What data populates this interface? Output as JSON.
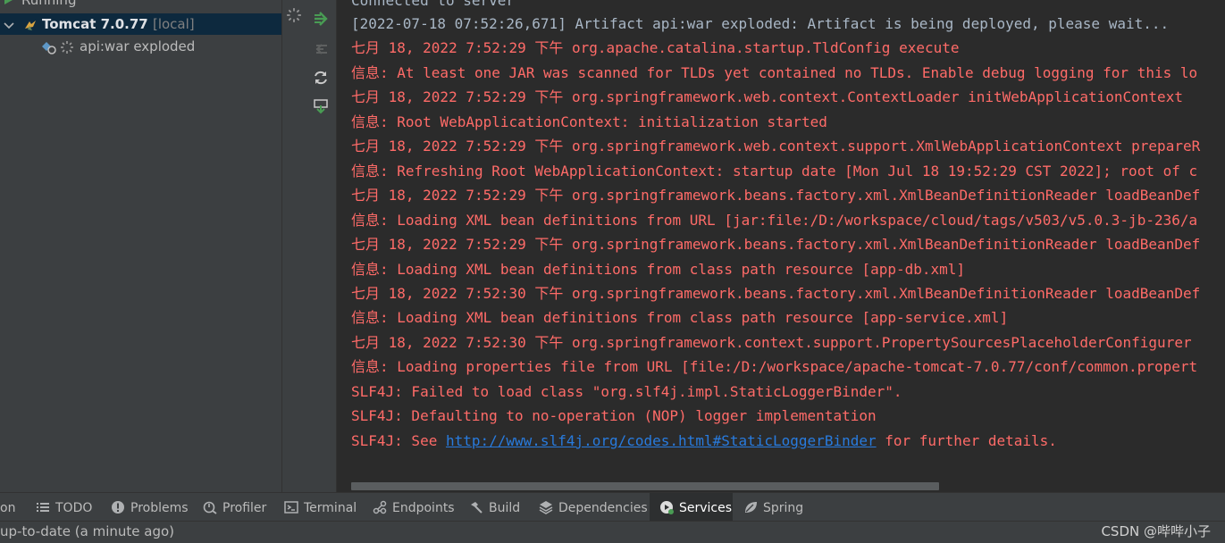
{
  "tree": {
    "running_label": "Running",
    "tomcat_name": "Tomcat 7.0.77",
    "tomcat_tag": "[local]",
    "artifact_label": "api:war exploded"
  },
  "console": {
    "lines": [
      {
        "text": "[2022-07-18 07:52:26,671] Artifact api:war exploded: Artifact is being deployed, please wait...",
        "kind": "plain"
      },
      {
        "text": "七月 18, 2022 7:52:29 下午 org.apache.catalina.startup.TldConfig execute",
        "kind": "err"
      },
      {
        "text": "信息: At least one JAR was scanned for TLDs yet contained no TLDs. Enable debug logging for this lo",
        "kind": "err"
      },
      {
        "text": "七月 18, 2022 7:52:29 下午 org.springframework.web.context.ContextLoader initWebApplicationContext",
        "kind": "err"
      },
      {
        "text": "信息: Root WebApplicationContext: initialization started",
        "kind": "err"
      },
      {
        "text": "七月 18, 2022 7:52:29 下午 org.springframework.web.context.support.XmlWebApplicationContext prepareR",
        "kind": "err"
      },
      {
        "text": "信息: Refreshing Root WebApplicationContext: startup date [Mon Jul 18 19:52:29 CST 2022]; root of c",
        "kind": "err"
      },
      {
        "text": "七月 18, 2022 7:52:29 下午 org.springframework.beans.factory.xml.XmlBeanDefinitionReader loadBeanDef",
        "kind": "err"
      },
      {
        "text": "信息: Loading XML bean definitions from URL [jar:file:/D:/workspace/cloud/tags/v503/v5.0.3-jb-236/a",
        "kind": "err"
      },
      {
        "text": "七月 18, 2022 7:52:29 下午 org.springframework.beans.factory.xml.XmlBeanDefinitionReader loadBeanDef",
        "kind": "err"
      },
      {
        "text": "信息: Loading XML bean definitions from class path resource [app-db.xml]",
        "kind": "err"
      },
      {
        "text": "七月 18, 2022 7:52:30 下午 org.springframework.beans.factory.xml.XmlBeanDefinitionReader loadBeanDef",
        "kind": "err"
      },
      {
        "text": "信息: Loading XML bean definitions from class path resource [app-service.xml]",
        "kind": "err"
      },
      {
        "text": "七月 18, 2022 7:52:30 下午 org.springframework.context.support.PropertySourcesPlaceholderConfigurer",
        "kind": "err"
      },
      {
        "text": "信息: Loading properties file from URL [file:/D:/workspace/apache-tomcat-7.0.77/conf/common.propert",
        "kind": "err"
      },
      {
        "text": "SLF4J: Failed to load class \"org.slf4j.impl.StaticLoggerBinder\".",
        "kind": "err"
      },
      {
        "text": "SLF4J: Defaulting to no-operation (NOP) logger implementation",
        "kind": "err"
      }
    ],
    "last_line": {
      "prefix": "SLF4J: See ",
      "link": "http://www.slf4j.org/codes.html#StaticLoggerBinder",
      "suffix": " for further details."
    }
  },
  "tabs": [
    {
      "label": "on",
      "icon": "none"
    },
    {
      "label": "TODO",
      "icon": "list-icon"
    },
    {
      "label": "Problems",
      "icon": "alert-icon"
    },
    {
      "label": "Profiler",
      "icon": "profiler-icon"
    },
    {
      "label": "Terminal",
      "icon": "terminal-icon"
    },
    {
      "label": "Endpoints",
      "icon": "endpoints-icon"
    },
    {
      "label": "Build",
      "icon": "hammer-icon"
    },
    {
      "label": "Dependencies",
      "icon": "layers-icon"
    },
    {
      "label": "Services",
      "icon": "services-icon",
      "active": true
    },
    {
      "label": "Spring",
      "icon": "spring-leaf-icon"
    }
  ],
  "status": {
    "text": "up-to-date (a minute ago)",
    "watermark": "CSDN @哔哔小子"
  },
  "colors": {
    "error_text": "#ff6b68",
    "plain_text": "#a9b7c6",
    "link": "#287bde",
    "selection": "#0d293e",
    "run_green": "#499c54"
  }
}
